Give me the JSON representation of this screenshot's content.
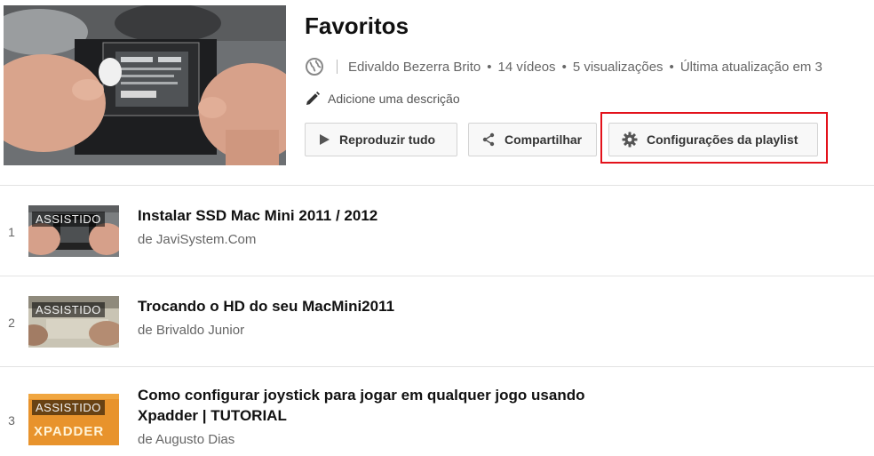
{
  "playlist": {
    "title": "Favoritos",
    "owner": "Edivaldo Bezerra Brito",
    "video_count": "14 vídeos",
    "views": "5 visualizações",
    "last_updated": "Última atualização em 3",
    "description_prompt": "Adicione uma descrição"
  },
  "actions": {
    "play_all": "Reproduzir tudo",
    "share": "Compartilhar",
    "settings": "Configurações da playlist"
  },
  "highlight_color": "#e3121b",
  "videos": [
    {
      "index": "1",
      "watched_label": "ASSISTIDO",
      "title": "Instalar SSD Mac Mini 2011 / 2012",
      "author": "de JaviSystem.Com"
    },
    {
      "index": "2",
      "watched_label": "ASSISTIDO",
      "title": "Trocando o HD do seu MacMini2011",
      "author": "de Brivaldo Junior"
    },
    {
      "index": "3",
      "watched_label": "ASSISTIDO",
      "title": "Como configurar joystick para jogar em qualquer jogo usando Xpadder | TUTORIAL",
      "author": "de Augusto Dias",
      "thumb_text": "XPADDER"
    }
  ]
}
